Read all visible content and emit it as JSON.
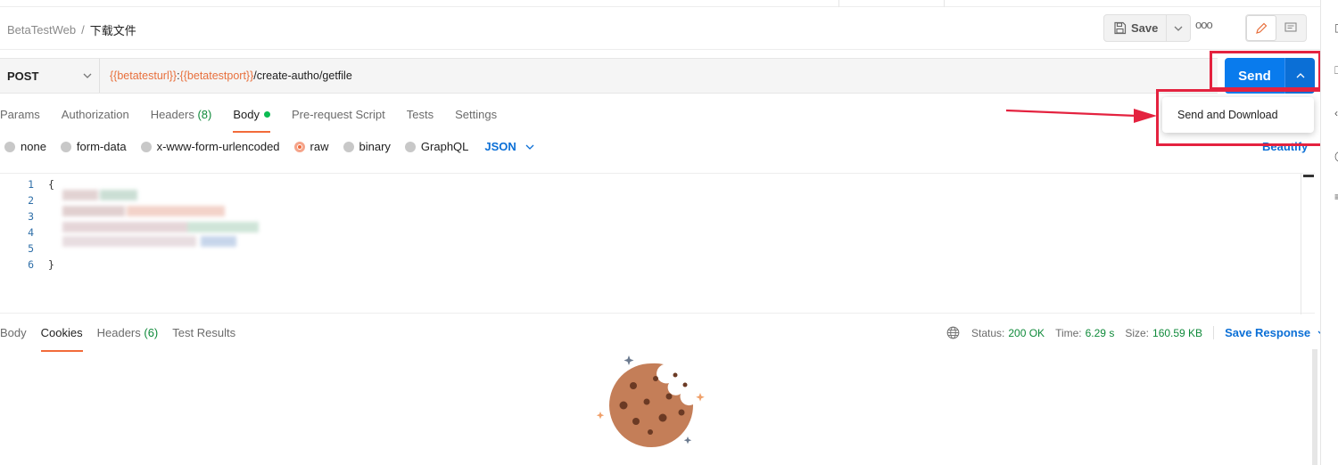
{
  "breadcrumb": {
    "parent": "BetaTestWeb",
    "separator": "/",
    "current": "下载文件"
  },
  "toolbar": {
    "save_label": "Save",
    "more_label": "ooo"
  },
  "request": {
    "method": "POST",
    "url_parts": {
      "var1": "{{betatesturl}}",
      "colon": ":",
      "var2": "{{betatestport}}",
      "path": "/create-autho/getfile"
    }
  },
  "send": {
    "label": "Send",
    "dropdown_item": "Send and Download"
  },
  "request_tabs": [
    {
      "label": "Params"
    },
    {
      "label": "Authorization"
    },
    {
      "label": "Headers",
      "count": "(8)"
    },
    {
      "label": "Body"
    },
    {
      "label": "Pre-request Script"
    },
    {
      "label": "Tests"
    },
    {
      "label": "Settings"
    }
  ],
  "body_types": [
    "none",
    "form-data",
    "x-www-form-urlencoded",
    "raw",
    "binary",
    "GraphQL"
  ],
  "body_format": "JSON",
  "beautify_label": "Beautify",
  "editor": {
    "line_numbers": [
      "1",
      "2",
      "3",
      "4",
      "5",
      "6"
    ],
    "open_brace": "{",
    "close_brace": "}"
  },
  "response_tabs": [
    {
      "label": "Body"
    },
    {
      "label": "Cookies"
    },
    {
      "label": "Headers",
      "count": "(6)"
    },
    {
      "label": "Test Results"
    }
  ],
  "response_meta": {
    "status_label": "Status:",
    "status_value": "200 OK",
    "time_label": "Time:",
    "time_value": "6.29 s",
    "size_label": "Size:",
    "size_value": "160.59 KB",
    "save_response_label": "Save Response"
  },
  "colors": {
    "accent": "#f26b3a",
    "send_blue": "#097bed",
    "annotation_red": "#e4223f",
    "success_green": "#0f8a3a"
  }
}
